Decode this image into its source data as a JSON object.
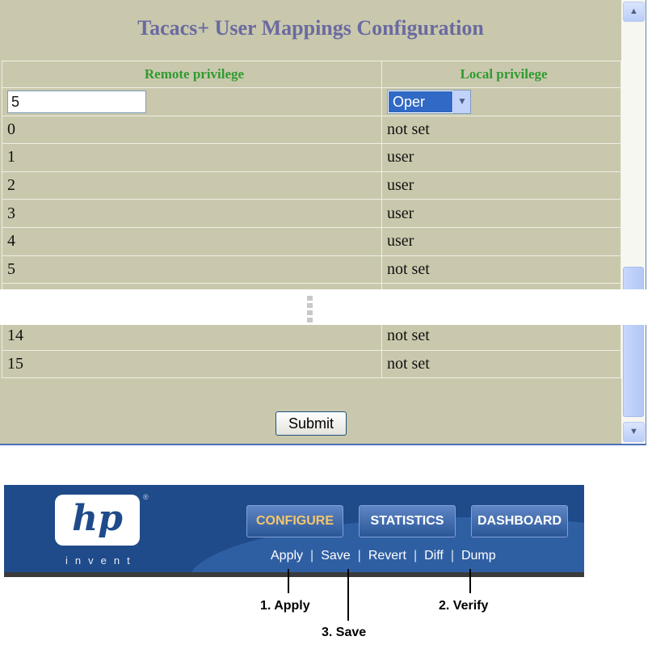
{
  "page": {
    "title": "Tacacs+ User Mappings Configuration",
    "headers": {
      "remote": "Remote privilege",
      "local": "Local privilege"
    },
    "input": {
      "remote_value": "5",
      "local_selected": "Oper"
    },
    "rows_top": [
      {
        "remote": "0",
        "local": "not set"
      },
      {
        "remote": "1",
        "local": "user"
      },
      {
        "remote": "2",
        "local": "user"
      },
      {
        "remote": "3",
        "local": "user"
      },
      {
        "remote": "4",
        "local": "user"
      },
      {
        "remote": "5",
        "local": "not set"
      }
    ],
    "rows_bottom": [
      {
        "remote": "14",
        "local": "not set"
      },
      {
        "remote": "15",
        "local": "not set"
      }
    ],
    "submit_label": "Submit"
  },
  "header": {
    "logo_text": "hp",
    "logo_reg": "®",
    "invent": "invent",
    "nav": [
      "CONFIGURE",
      "STATISTICS",
      "DASHBOARD"
    ],
    "active_nav": "CONFIGURE",
    "actions": [
      "Apply",
      "Save",
      "Revert",
      "Diff",
      "Dump"
    ],
    "separator": "|"
  },
  "annotations": {
    "apply": "1. Apply",
    "verify": "2. Verify",
    "save": "3. Save"
  },
  "icons": {
    "scroll_up": "scroll-up-icon",
    "scroll_down": "scroll-down-icon",
    "dropdown": "chevron-down-icon",
    "ellipsis": "vertical-ellipsis-icon"
  },
  "colors": {
    "panel": "#c9c8ad",
    "title": "#6a6aa0",
    "header_text": "#2f9b2f",
    "hp_blue": "#1f4b8a",
    "active_nav": "#f6c66a",
    "selection": "#3169c6"
  }
}
